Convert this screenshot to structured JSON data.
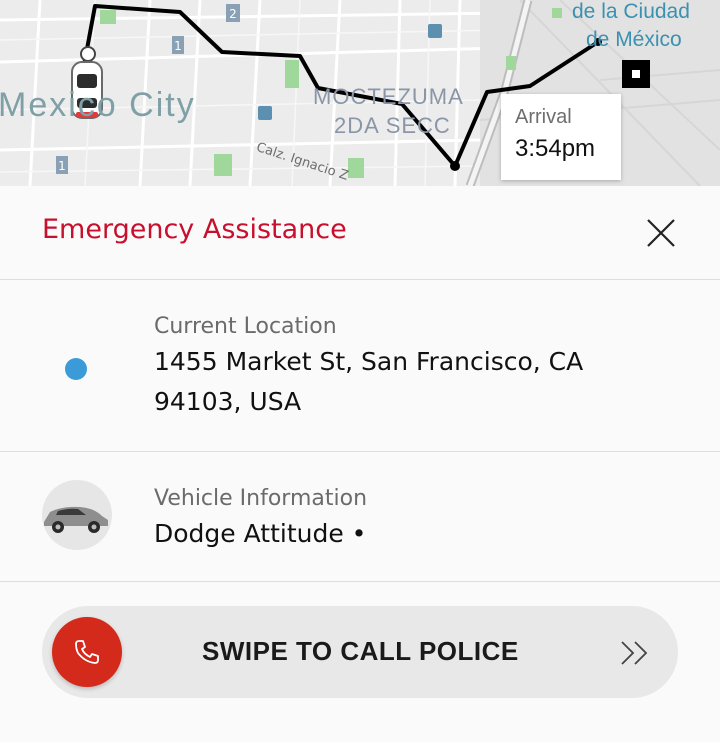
{
  "map": {
    "city_label": "Mexico City",
    "colonia_line1": "MOCTEZUMA",
    "colonia_line2": "2DA SECC",
    "street_label": "Calz. Ignacio Z",
    "district_line1": "de la Ciudad",
    "district_line2": "de México",
    "route_badges": [
      "2",
      "1",
      "1"
    ],
    "arrival": {
      "label": "Arrival",
      "time": "3:54pm"
    }
  },
  "sheet": {
    "title": "Emergency Assistance",
    "close_icon": "close-icon",
    "location": {
      "label": "Current Location",
      "value": "1455 Market St, San Francisco, CA 94103, USA"
    },
    "vehicle": {
      "label": "Vehicle Information",
      "value": "Dodge Attitude •"
    },
    "swipe": {
      "label": "SWIPE TO CALL POLICE",
      "icon": "phone-icon"
    }
  },
  "colors": {
    "accent_red": "#c8102e",
    "call_button_red": "#d42a1c",
    "location_dot_blue": "#3b9bd9",
    "route_black": "#000000"
  }
}
